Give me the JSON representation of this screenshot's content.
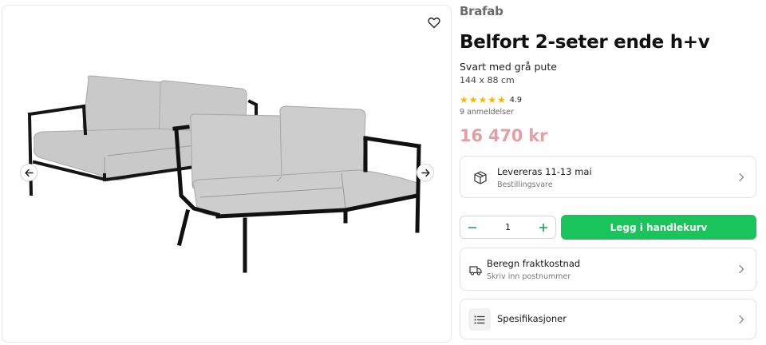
{
  "product": {
    "brand": "Brafab",
    "title": "Belfort 2-seter ende h+v",
    "subtitle": "Svart med grå pute",
    "dimensions": "144 x 88 cm",
    "rating": "4.9",
    "rating_stars": 5,
    "reviews": "9 anmeldelser",
    "price": "16 470 kr"
  },
  "delivery": {
    "title": "Levereras 11-13 mai",
    "subtitle": "Bestillingsvare"
  },
  "cart": {
    "quantity": "1",
    "add_label": "Legg i handlekurv"
  },
  "shipping": {
    "title": "Beregn fraktkostnad",
    "subtitle": "Skriv inn postnummer"
  },
  "specs": {
    "title": "Spesifikasjoner"
  },
  "icons": {
    "favorite": "heart-icon",
    "prev": "arrow-left-icon",
    "next": "arrow-right-icon",
    "delivery": "package-icon",
    "shipping": "truck-icon",
    "specs": "list-icon",
    "chevron": "chevron-right-icon"
  },
  "colors": {
    "price": "#e2a0a4",
    "cta": "#19c45a",
    "star": "#f5b800",
    "brand": "#6b6b6b"
  }
}
